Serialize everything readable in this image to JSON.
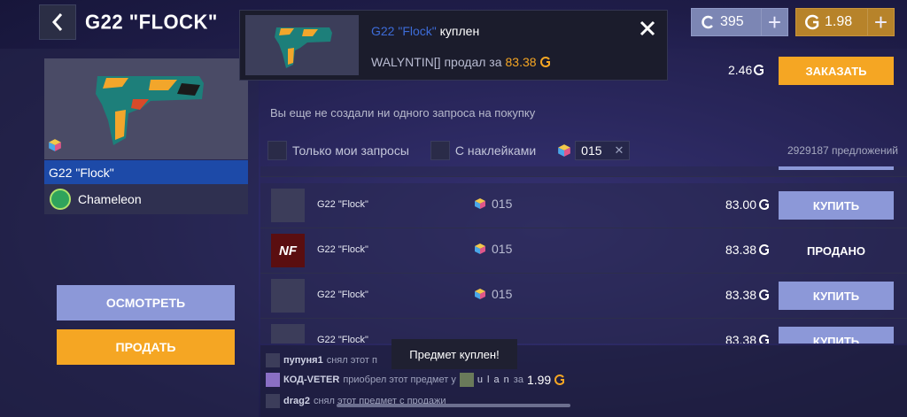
{
  "header": {
    "title": "G22 \"FLOCK\"",
    "back_icon": "chevron-left-icon"
  },
  "currency": {
    "silver": {
      "value": "395",
      "plus": "+",
      "color": "#7c86b4"
    },
    "gold": {
      "value": "1.98",
      "plus": "+",
      "color": "#b7832a"
    }
  },
  "notification": {
    "item": "G22 \"Flock\"",
    "action": "куплен",
    "seller_text": "WALYNTIN[] продал за",
    "amount": "83.38"
  },
  "left": {
    "selected_name": "G22 \"Flock\"",
    "collection": "Chameleon",
    "inspect_label": "ОСМОТРЕТЬ",
    "sell_label": "ПРОДАТЬ"
  },
  "orders": {
    "price": "2.46",
    "order_label": "ЗАКАЗАТЬ",
    "empty_text": "Вы еще не создали ни одного запроса на покупку"
  },
  "filters": {
    "only_mine": "Только мои запросы",
    "with_stickers": "С наклейками",
    "sticker_tag": "015",
    "offers_count": "2929187 предложений"
  },
  "listings": [
    {
      "name": "G22 \"Flock\"",
      "sticker": "015",
      "price": "83.00",
      "action": "КУПИТЬ",
      "sold": false
    },
    {
      "name": "G22 \"Flock\"",
      "sticker": "015",
      "price": "83.38",
      "action": "ПРОДАНО",
      "sold": true,
      "thumb_text": "NF"
    },
    {
      "name": "G22 \"Flock\"",
      "sticker": "015",
      "price": "83.38",
      "action": "КУПИТЬ",
      "sold": false
    },
    {
      "name": "G22 \"Flock\"",
      "sticker": "",
      "price": "83.38",
      "action": "КУПИТЬ",
      "sold": false
    }
  ],
  "feed": [
    {
      "user": "пупуня1",
      "text": "снял этот п"
    },
    {
      "user": "КОД-VETER",
      "text": "приобрел этот предмет у",
      "seller": "u l a n",
      "za": "за",
      "amount": "1.99"
    },
    {
      "user": "drag2",
      "text": "снял этот предмет с продажи"
    }
  ],
  "toast": "Предмет куплен!",
  "colors": {
    "accent_orange": "#f5a623",
    "button_blue": "#8c98d8",
    "selected_blue": "#1d4aa8"
  }
}
